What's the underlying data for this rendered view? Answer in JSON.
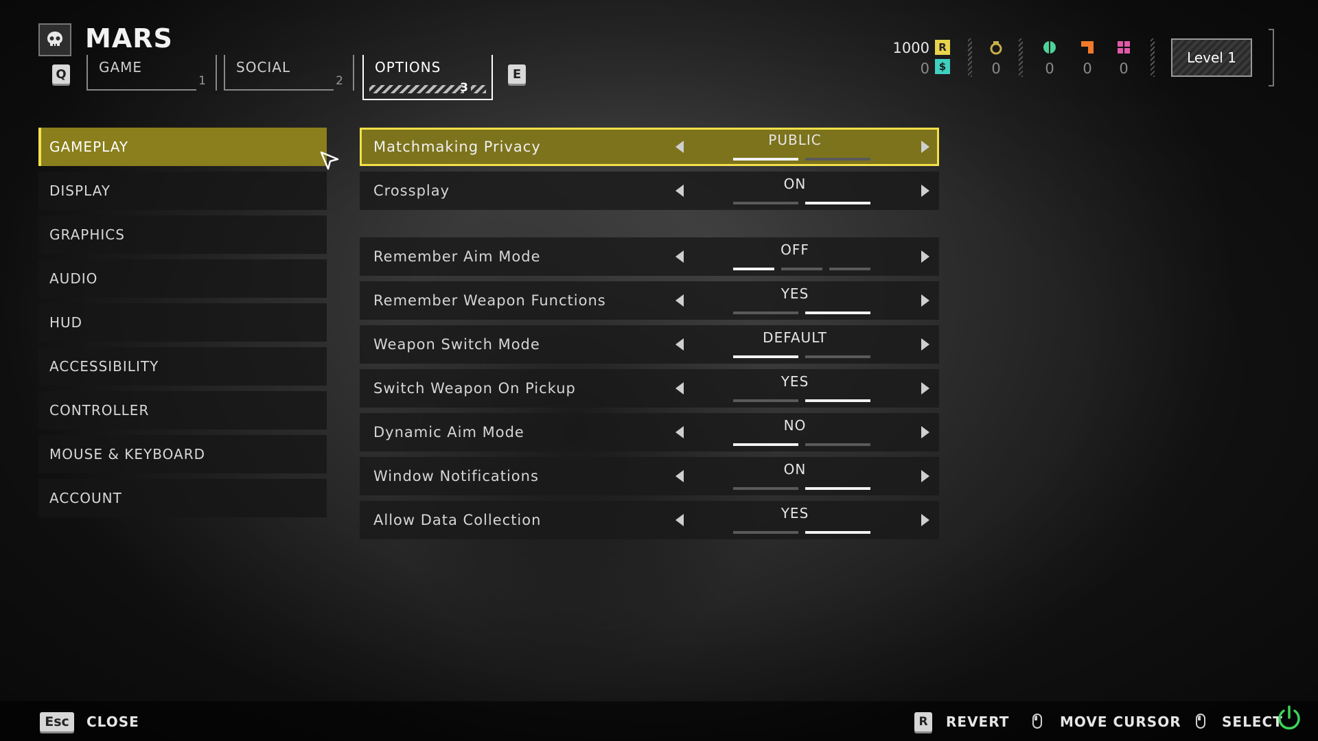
{
  "header": {
    "title": "MARS",
    "skull_icon": "skull-icon",
    "prev_tab_key": "Q",
    "next_tab_key": "E",
    "tabs": [
      {
        "label": "GAME",
        "number": "1"
      },
      {
        "label": "SOCIAL",
        "number": "2"
      },
      {
        "label": "OPTIONS",
        "number": "3"
      }
    ],
    "active_tab": "OPTIONS",
    "currencies": {
      "requisition": "1000",
      "super_credits": "0",
      "medals": "0",
      "samples_common": "0",
      "samples_rare": "0",
      "samples_super": "0"
    },
    "level": "Level 1",
    "colors": {
      "requisition": "#e8d44d",
      "super_credits": "#3fd0c0",
      "medal": "#c9b04a",
      "common": "#4fd19a",
      "rare": "#f07a2a",
      "super": "#e05aa8"
    }
  },
  "menu": {
    "items": [
      "GAMEPLAY",
      "DISPLAY",
      "GRAPHICS",
      "AUDIO",
      "HUD",
      "ACCESSIBILITY",
      "CONTROLLER",
      "MOUSE & KEYBOARD",
      "ACCOUNT"
    ],
    "active": "GAMEPLAY"
  },
  "settings": [
    {
      "name": "Matchmaking Privacy",
      "value": "PUBLIC",
      "option_count": 2,
      "selected_index": 0
    },
    {
      "name": "Crossplay",
      "value": "ON",
      "option_count": 2,
      "selected_index": 1
    },
    {
      "name": "Remember Aim Mode",
      "value": "OFF",
      "option_count": 3,
      "selected_index": 0
    },
    {
      "name": "Remember Weapon Functions",
      "value": "YES",
      "option_count": 2,
      "selected_index": 1
    },
    {
      "name": "Weapon Switch Mode",
      "value": "DEFAULT",
      "option_count": 2,
      "selected_index": 0
    },
    {
      "name": "Switch Weapon On Pickup",
      "value": "YES",
      "option_count": 2,
      "selected_index": 1
    },
    {
      "name": "Dynamic Aim Mode",
      "value": "NO",
      "option_count": 2,
      "selected_index": 0
    },
    {
      "name": "Window Notifications",
      "value": "ON",
      "option_count": 2,
      "selected_index": 1
    },
    {
      "name": "Allow Data Collection",
      "value": "YES",
      "option_count": 2,
      "selected_index": 1
    }
  ],
  "footer": {
    "close_key": "Esc",
    "close_label": "CLOSE",
    "revert_key": "R",
    "revert_label": "REVERT",
    "move_cursor_label": "MOVE CURSOR",
    "select_label": "SELECT"
  }
}
